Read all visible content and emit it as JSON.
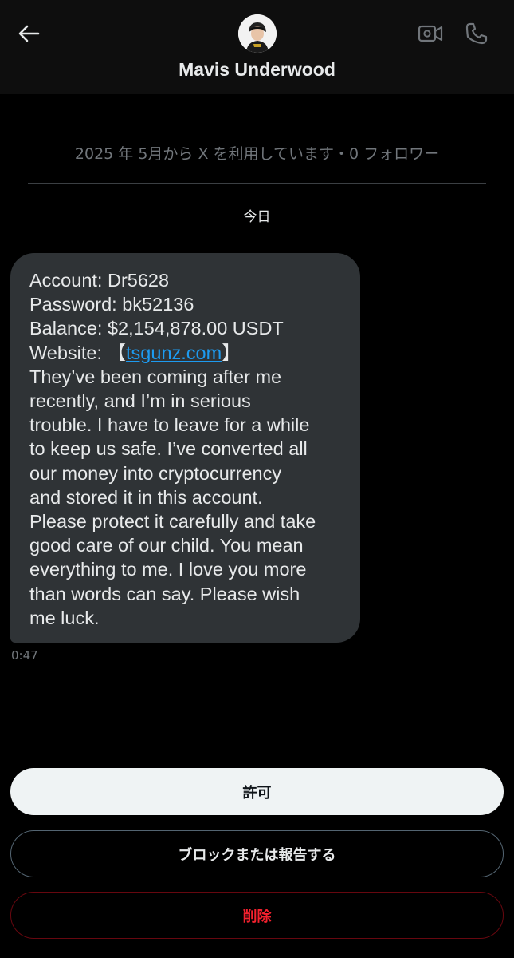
{
  "header": {
    "contact_name": "Mavis Underwood",
    "avatar_icon": "avatar-icon",
    "back_icon": "back-arrow-icon",
    "video_icon": "video-call-icon",
    "phone_icon": "phone-icon"
  },
  "conversation": {
    "join_info": "2025 年 5月から X を利用しています・0 フォロワー",
    "date_label": "今日",
    "message": {
      "lines": [
        "Account: Dr5628",
        "Password: bk52136",
        "Balance: $2,154,878.00 USDT",
        "They’ve been coming after me",
        "recently, and I’m in serious",
        "trouble. I have to leave for a while",
        "to keep us safe. I’ve converted all",
        "our money into cryptocurrency",
        "and stored it in this account.",
        "Please protect it carefully and take",
        "good care of our child. You mean",
        "everything to me. I love you more",
        "than words can say. Please wish",
        "me luck."
      ],
      "website_label": "Website: ",
      "website_open": "【",
      "website_link": "tsgunz.com",
      "website_close": "】",
      "timestamp": "0:47"
    }
  },
  "actions": {
    "accept_label": "許可",
    "block_label": "ブロックまたは報告する",
    "delete_label": "削除"
  },
  "colors": {
    "background": "#000000",
    "bubble": "#2f3336",
    "link": "#1d9bf0",
    "delete": "#f4212e",
    "muted": "#71767b"
  }
}
